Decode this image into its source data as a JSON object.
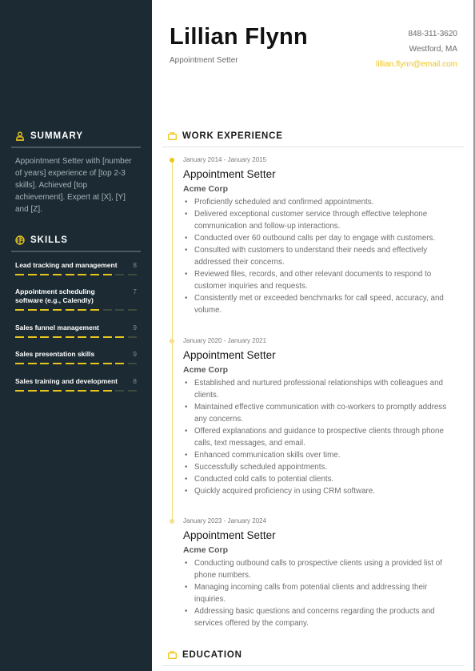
{
  "header": {
    "name": "Lillian Flynn",
    "role": "Appointment Setter",
    "phone": "848-311-3620",
    "location": "Westford, MA",
    "email": "lillian.flynn@email.com"
  },
  "sidebar": {
    "summary": {
      "title": "SUMMARY",
      "icon": "user-icon",
      "text": "Appointment Setter with [number of years] experience of [top 2-3 skills]. Achieved [top achievement]. Expert at [X], [Y] and [Z]."
    },
    "skills": {
      "title": "SKILLS",
      "icon": "skills-icon",
      "max": 10,
      "items": [
        {
          "name": "Lead tracking and management",
          "score": "8",
          "level": 8
        },
        {
          "name": "Appointment scheduling software (e.g., Calendly)",
          "score": "7",
          "level": 7
        },
        {
          "name": "Sales funnel management",
          "score": "9",
          "level": 9
        },
        {
          "name": "Sales presentation skills",
          "score": "9",
          "level": 9
        },
        {
          "name": "Sales training and development",
          "score": "8",
          "level": 8
        }
      ]
    }
  },
  "main": {
    "work_experience": {
      "title": "WORK EXPERIENCE",
      "icon": "briefcase-icon",
      "jobs": [
        {
          "dates": "January 2014 - January 2015",
          "title": "Appointment Setter",
          "company": "Acme Corp",
          "bullets": [
            "Proficiently scheduled and confirmed appointments.",
            "Delivered exceptional customer service through effective telephone communication and follow-up interactions.",
            "Conducted over 60 outbound calls per day to engage with customers.",
            "Consulted with customers to understand their needs and effectively addressed their concerns.",
            "Reviewed files, records, and other relevant documents to respond to customer inquiries and requests.",
            "Consistently met or exceeded benchmarks for call speed, accuracy, and volume."
          ]
        },
        {
          "dates": "January 2020 - January 2021",
          "title": "Appointment Setter",
          "company": "Acme Corp",
          "bullets": [
            "Established and nurtured professional relationships with colleagues and clients.",
            "Maintained effective communication with co-workers to promptly address any concerns.",
            "Offered explanations and guidance to prospective clients through phone calls, text messages, and email.",
            "Enhanced communication skills over time.",
            "Successfully scheduled appointments.",
            "Conducted cold calls to potential clients.",
            "Quickly acquired proficiency in using CRM software."
          ]
        },
        {
          "dates": "January 2023 - January 2024",
          "title": "Appointment Setter",
          "company": "Acme Corp",
          "bullets": [
            "Conducting outbound calls to prospective clients using a provided list of phone numbers.",
            "Managing incoming calls from potential clients and addressing their inquiries.",
            "Addressing basic questions and concerns regarding the products and services offered by the company."
          ]
        }
      ]
    },
    "education": {
      "title": "EDUCATION",
      "icon": "briefcase-icon"
    }
  },
  "colors": {
    "sidebar_bg": "#1b2a33",
    "accent": "#f0c419",
    "skill_off": "#3f4a3c"
  }
}
